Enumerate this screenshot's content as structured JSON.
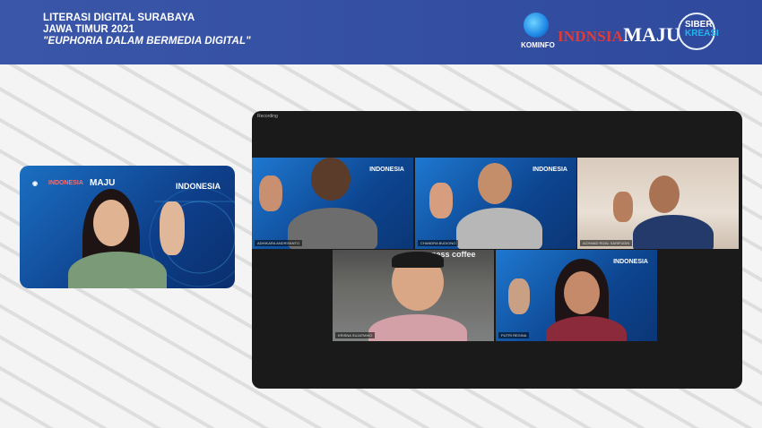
{
  "header": {
    "title_line1": "LITERASI DIGITAL SURABAYA",
    "title_line2": "JAWA TIMUR 2021",
    "title_line3": "\"EUPHORIA DALAM BERMEDIA DIGITAL\"",
    "logo_kominfo": "KOMINFO",
    "logo_indonesia": "INDNSIA",
    "logo_maju": "MAJU",
    "logo_siber": "SIBER",
    "logo_kreasi": "KREASI",
    "bg_color": "#3450a3"
  },
  "speaker_panel": {
    "brand_small": "INDONESIA",
    "brand_maju": "MAJU",
    "brand_big": "INDONESIA"
  },
  "zoom": {
    "recording_label": "Recording",
    "tiles": [
      {
        "name": "ADHIKARA ANDRIYANTO",
        "brand": "INDONESIA",
        "bg": "blue"
      },
      {
        "name": "CHANDRA BUDIONO",
        "brand": "INDONESIA",
        "bg": "blue"
      },
      {
        "name": "ACHMAD RIZAL SARIFUDIN",
        "brand": "",
        "bg": "beige"
      },
      {
        "name": "KRISNA SUJATMIKO",
        "brand": "ness coffee",
        "bg": "cafe"
      },
      {
        "name": "PUTRI REGINA",
        "brand": "INDONESIA",
        "bg": "blue"
      }
    ]
  }
}
